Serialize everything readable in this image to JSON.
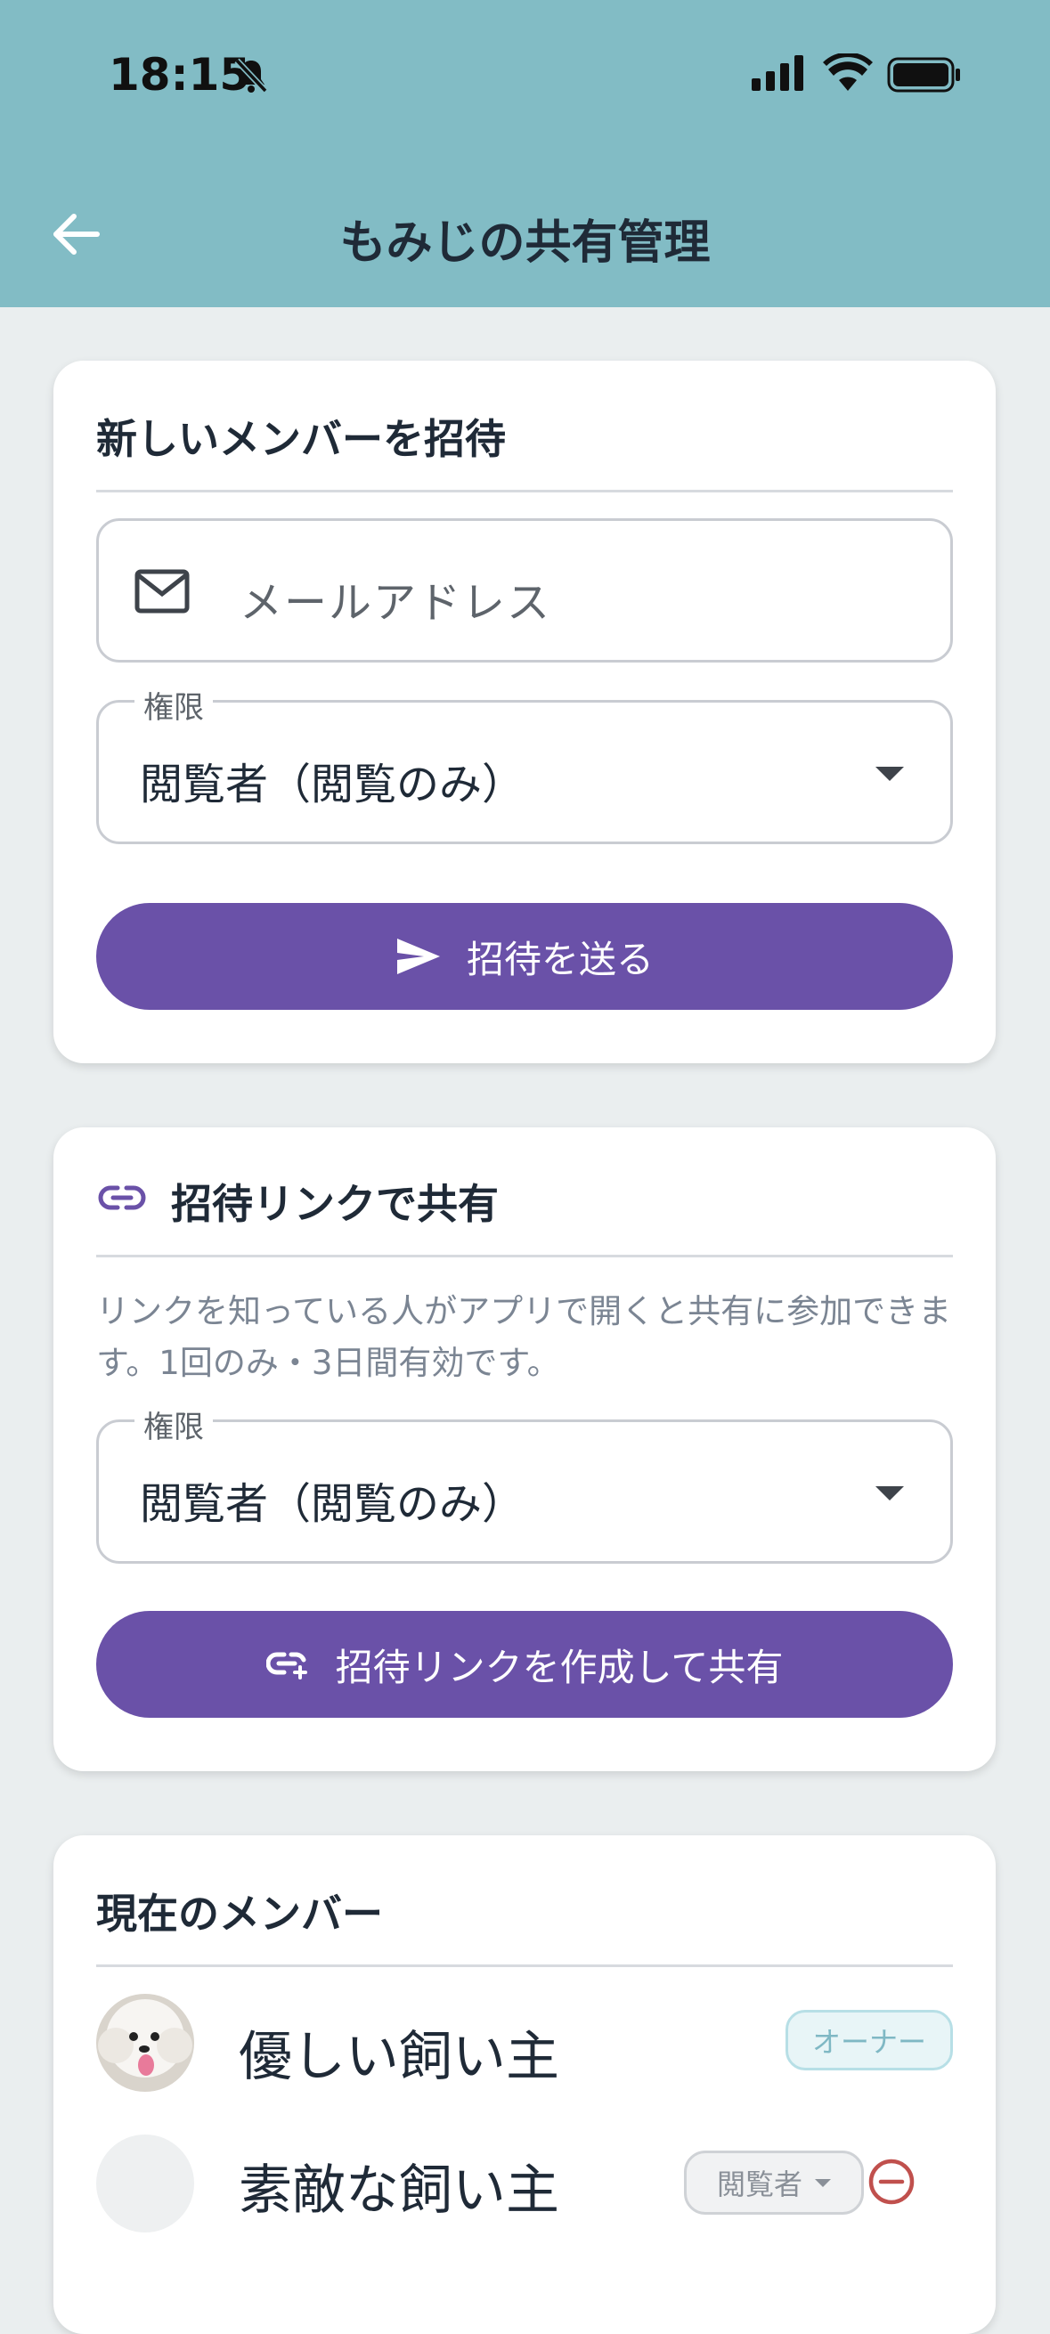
{
  "status_bar": {
    "time": "18:15"
  },
  "header": {
    "title": "もみじの共有管理"
  },
  "invite_card": {
    "title": "新しいメンバーを招待",
    "email_placeholder": "メールアドレス",
    "permission_label": "権限",
    "permission_value": "閲覧者（閲覧のみ）",
    "send_button": "招待を送る"
  },
  "link_card": {
    "title": "招待リンクで共有",
    "description": "リンクを知っている人がアプリで開くと共有に参加できます。1回のみ・3日間有効です。",
    "permission_label": "権限",
    "permission_value": "閲覧者（閲覧のみ）",
    "create_button": "招待リンクを作成して共有"
  },
  "members_card": {
    "title": "現在のメンバー",
    "members": [
      {
        "name": "優しい飼い主",
        "role": "オーナー"
      },
      {
        "name": "素敵な飼い主",
        "role": "閲覧者"
      }
    ]
  },
  "colors": {
    "header": "#82bcc5",
    "accent": "#6a51a8",
    "remove": "#c0504d"
  }
}
